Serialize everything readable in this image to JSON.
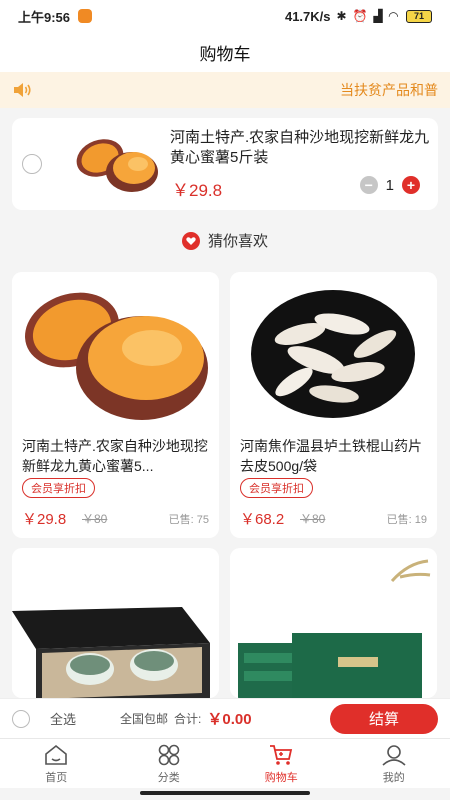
{
  "status_bar": {
    "time": "上午9:56",
    "network_speed": "41.7K/s",
    "battery": "71"
  },
  "header": {
    "title": "购物车"
  },
  "notice": {
    "text": "当扶贫产品和普"
  },
  "cart": {
    "items": [
      {
        "name": "河南土特产.农家自种沙地现挖新鲜龙九黄心蜜薯5斤装",
        "price": "￥29.8",
        "quantity": "1",
        "minus_label": "−",
        "plus_label": "+"
      }
    ]
  },
  "recommend": {
    "title": "猜你喜欢",
    "products": [
      {
        "name": "河南土特产.农家自种沙地现挖新鲜龙九黄心蜜薯5...",
        "badge": "会员享折扣",
        "price": "￥29.8",
        "original_price": "￥80",
        "sold": "已售: 75"
      },
      {
        "name": "河南焦作温县垆土铁棍山药片去皮500g/袋",
        "badge": "会员享折扣",
        "price": "￥68.2",
        "original_price": "￥80",
        "sold": "已售: 19"
      }
    ]
  },
  "footer": {
    "select_all": "全选",
    "free_shipping": "全国包邮",
    "total_label": "合计:",
    "total_value": "￥0.00",
    "checkout": "结算"
  },
  "tabs": [
    {
      "label": "首页",
      "icon": "home-icon"
    },
    {
      "label": "分类",
      "icon": "category-icon"
    },
    {
      "label": "购物车",
      "icon": "cart-icon",
      "active": true
    },
    {
      "label": "我的",
      "icon": "profile-icon"
    }
  ],
  "colors": {
    "accent": "#e02f2a",
    "price": "#d9302a",
    "notice_text": "#e48a1e",
    "notice_bg": "#fdf3e3"
  }
}
